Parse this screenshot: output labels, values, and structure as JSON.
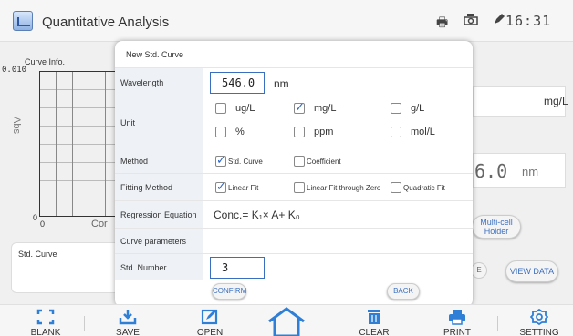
{
  "header": {
    "title": "Quantitative Analysis",
    "time": "16:31",
    "icons": [
      "printer-icon",
      "camera-icon",
      "pen-icon"
    ]
  },
  "background": {
    "curve_info_label": "Curve Info.",
    "y_axis_top": "0.010",
    "y_axis_zero": "0",
    "x_axis_zero": "0",
    "x_axis_label_partial": "Cor",
    "abs_label": "Abs",
    "std_curve_label": "Std. Curve",
    "unit_value": "mg/L",
    "wavelength_value": "6.0",
    "wavelength_unit": "nm",
    "multicell_label": "Multi-cell Holder",
    "small_round_label": "E",
    "view_data_label": "VIEW DATA"
  },
  "dialog": {
    "title": "New Std. Curve",
    "wavelength": {
      "label": "Wavelength",
      "value": "546.0",
      "unit": "nm"
    },
    "unit": {
      "label": "Unit",
      "options": [
        {
          "text": "ug/L",
          "checked": false
        },
        {
          "text": "mg/L",
          "checked": true
        },
        {
          "text": "g/L",
          "checked": false
        },
        {
          "text": "%",
          "checked": false
        },
        {
          "text": "ppm",
          "checked": false
        },
        {
          "text": "mol/L",
          "checked": false
        }
      ]
    },
    "method": {
      "label": "Method",
      "options": [
        {
          "text": "Std. Curve",
          "checked": true
        },
        {
          "text": "Coefficient",
          "checked": false
        }
      ]
    },
    "fitting": {
      "label": "Fitting Method",
      "options": [
        {
          "text": "Linear Fit",
          "checked": true
        },
        {
          "text": "Linear Fit through Zero",
          "checked": false
        },
        {
          "text": "Quadratic Fit",
          "checked": false
        }
      ]
    },
    "regression": {
      "label": "Regression Equation",
      "equation": "Conc.= K₁× A+ K₀"
    },
    "curve_params": {
      "label": "Curve parameters"
    },
    "std_number": {
      "label": "Std. Number",
      "value": "3"
    },
    "confirm_label": "CONFIRM",
    "back_label": "BACK"
  },
  "toolbar": {
    "items": [
      {
        "label": "BLANK",
        "icon": "blank-icon"
      },
      {
        "label": "SAVE",
        "icon": "save-icon"
      },
      {
        "label": "OPEN",
        "icon": "open-icon"
      },
      {
        "label": "",
        "icon": "home-icon"
      },
      {
        "label": "CLEAR",
        "icon": "trash-icon"
      },
      {
        "label": "PRINT",
        "icon": "printer-icon"
      },
      {
        "label": "SETTING",
        "icon": "gear-icon"
      }
    ]
  },
  "colors": {
    "accent": "#2f7fd6",
    "check": "#2f66c2",
    "label_bg": "#eef2f7"
  }
}
